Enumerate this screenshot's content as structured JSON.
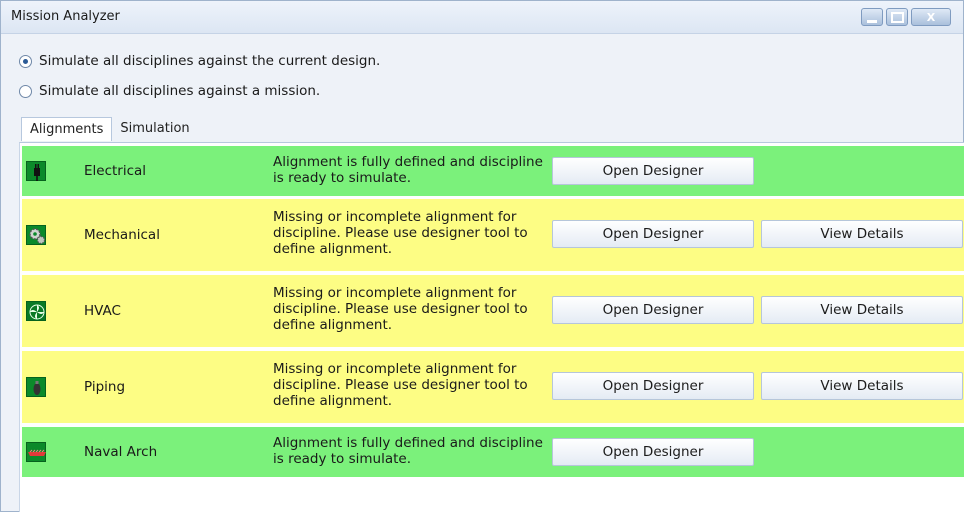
{
  "window": {
    "title": "Mission Analyzer",
    "controls": {
      "minimize": "",
      "maximize": "",
      "close": "X"
    }
  },
  "options": [
    {
      "label": "Simulate all disciplines against the current design.",
      "selected": true
    },
    {
      "label": "Simulate all disciplines against a mission.",
      "selected": false
    }
  ],
  "tabs": [
    {
      "label": "Alignments",
      "active": true
    },
    {
      "label": "Simulation",
      "active": false
    }
  ],
  "disciplines": [
    {
      "name": "Electrical",
      "icon": "plug-icon",
      "state": "ready",
      "status": "Alignment is fully defined and discipline is ready to simulate.",
      "open_label": "Open Designer",
      "details_label": null
    },
    {
      "name": "Mechanical",
      "icon": "gears-icon",
      "state": "incomplete",
      "status": "Missing or incomplete alignment for discipline. Please use designer tool to define alignment.",
      "open_label": "Open Designer",
      "details_label": "View Details"
    },
    {
      "name": "HVAC",
      "icon": "fan-icon",
      "state": "incomplete",
      "status": "Missing or incomplete alignment for discipline. Please use designer tool to define alignment.",
      "open_label": "Open Designer",
      "details_label": "View Details"
    },
    {
      "name": "Piping",
      "icon": "valve-icon",
      "state": "incomplete",
      "status": "Missing or incomplete alignment for discipline. Please use designer tool to define alignment.",
      "open_label": "Open Designer",
      "details_label": "View Details"
    },
    {
      "name": "Naval Arch",
      "icon": "hull-icon",
      "state": "ready",
      "status": "Alignment is fully defined and discipline is ready to simulate.",
      "open_label": "Open Designer",
      "details_label": null
    }
  ],
  "status_colors": {
    "ready": "#7bf17b",
    "incomplete": "#fdfd84"
  }
}
